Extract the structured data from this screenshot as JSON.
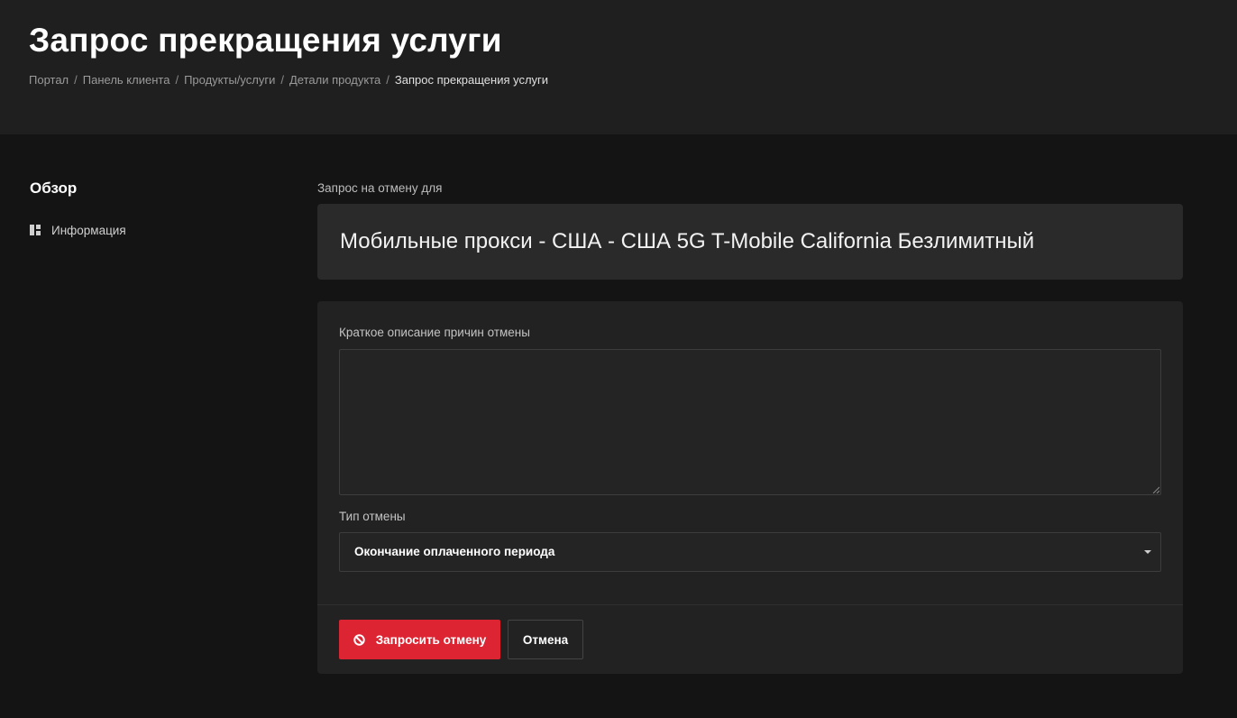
{
  "header": {
    "title": "Запрос прекращения услуги",
    "breadcrumb": [
      "Портал",
      "Панель клиента",
      "Продукты/услуги",
      "Детали продукта",
      "Запрос прекращения услуги"
    ],
    "breadcrumb_separator": "/"
  },
  "sidebar": {
    "title": "Обзор",
    "items": [
      {
        "label": "Информация",
        "icon": "dashboard-icon"
      }
    ]
  },
  "main": {
    "request_label": "Запрос на отмену для",
    "product_name": "Мобильные прокси - США - США 5G T-Mobile California Безлимитный",
    "form": {
      "reason_label": "Краткое описание причин отмены",
      "reason_value": "",
      "type_label": "Тип отмены",
      "type_selected": "Окончание оплаченного периода"
    },
    "buttons": {
      "submit_label": "Запросить отмену",
      "submit_icon": "ban-icon",
      "cancel_label": "Отмена"
    }
  },
  "colors": {
    "accent": "#dc2433",
    "header_bg": "#1f1f1f",
    "page_bg": "#141414",
    "card_bg": "#2a2a2a",
    "form_bg": "#222222"
  }
}
